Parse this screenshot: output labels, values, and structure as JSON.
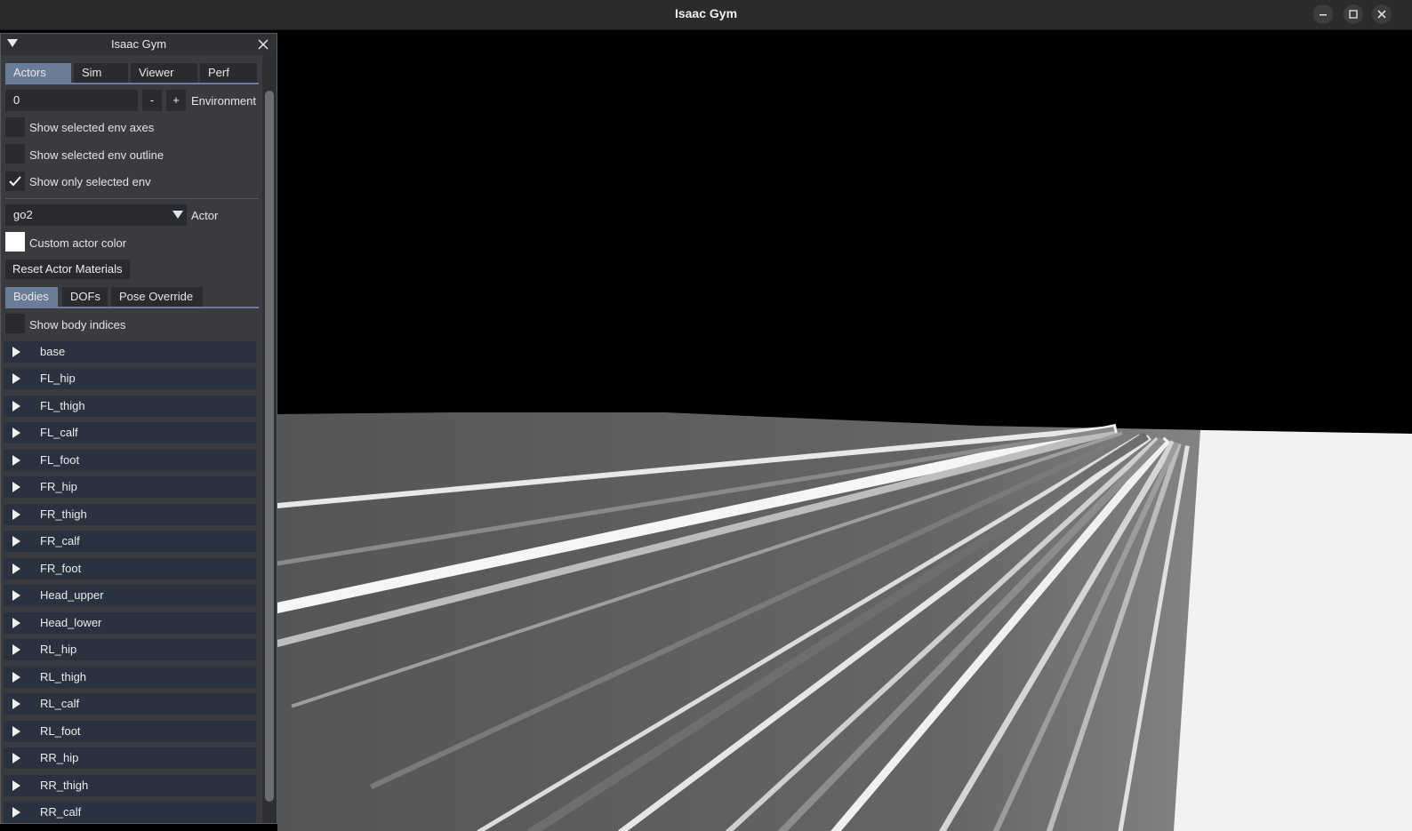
{
  "window": {
    "title": "Isaac Gym",
    "controls": [
      "minimize-icon",
      "maximize-icon",
      "close-icon"
    ]
  },
  "panel": {
    "title": "Isaac Gym",
    "tabs": [
      {
        "label": "Actors",
        "active": true
      },
      {
        "label": "Sim",
        "active": false
      },
      {
        "label": "Viewer",
        "active": false
      },
      {
        "label": "Perf",
        "active": false
      }
    ],
    "environment": {
      "value": "0",
      "minus": "-",
      "plus": "+",
      "label": "Environment"
    },
    "checkboxes": [
      {
        "label": "Show selected env axes",
        "checked": false
      },
      {
        "label": "Show selected env outline",
        "checked": false
      },
      {
        "label": "Show only selected env",
        "checked": true
      }
    ],
    "actor": {
      "value": "go2",
      "label": "Actor"
    },
    "custom_color": {
      "label": "Custom actor color",
      "color": "#ffffff"
    },
    "reset_button": "Reset Actor Materials",
    "subtabs": [
      {
        "label": "Bodies",
        "active": true
      },
      {
        "label": "DOFs",
        "active": false
      },
      {
        "label": "Pose Override",
        "active": false
      }
    ],
    "show_body_indices": {
      "label": "Show body indices",
      "checked": false
    },
    "bodies": [
      "base",
      "FL_hip",
      "FL_thigh",
      "FL_calf",
      "FL_foot",
      "FR_hip",
      "FR_thigh",
      "FR_calf",
      "FR_foot",
      "Head_upper",
      "Head_lower",
      "RL_hip",
      "RL_thigh",
      "RL_calf",
      "RL_foot",
      "RR_hip",
      "RR_thigh",
      "RR_calf"
    ]
  },
  "colors": {
    "accent": "#6b7c96",
    "panel_bg": "#3a3b3e",
    "row_bg": "#2a3240"
  }
}
